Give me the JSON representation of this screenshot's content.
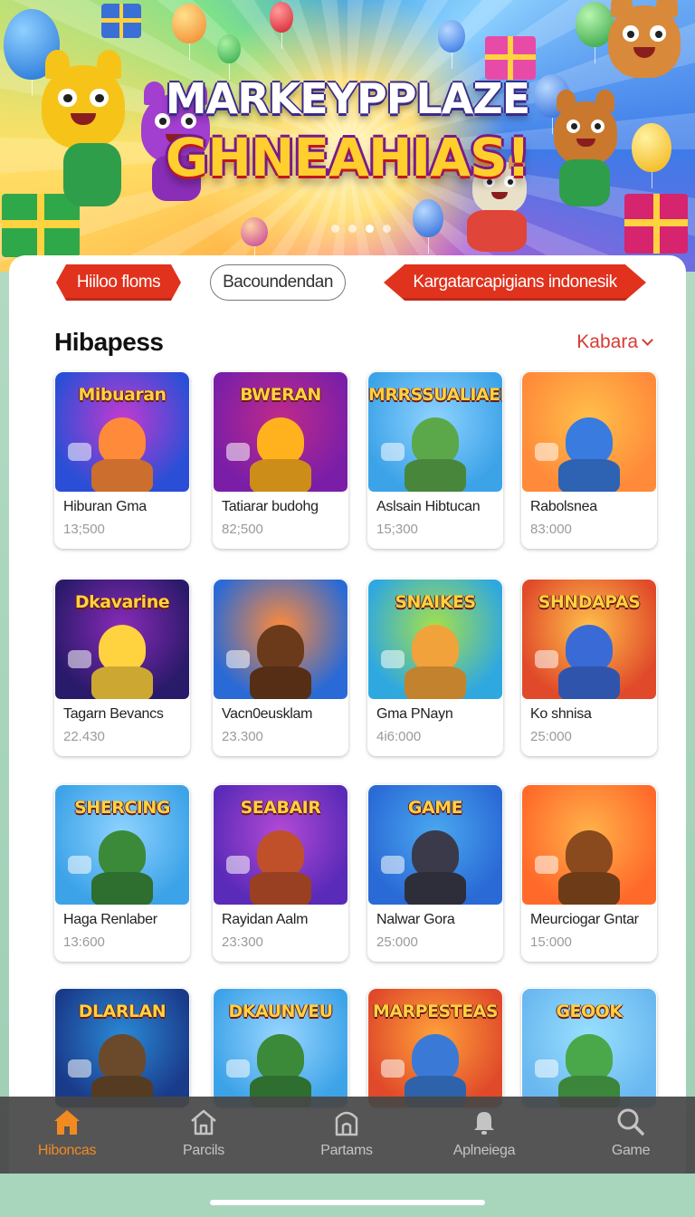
{
  "banner": {
    "title": "MARKEYPPLAZE",
    "subtitle": "GHNEAHIAS!",
    "carousel_dots": 4,
    "active_dot": 3
  },
  "filters": [
    {
      "label": "Hiiloo floms",
      "style": "red"
    },
    {
      "label": "Bacoundendan",
      "style": "outline"
    },
    {
      "label": "Kargatarcapigians indonesik",
      "style": "red"
    }
  ],
  "section": {
    "title": "Hibapess",
    "more_label": "Kabara"
  },
  "items": [
    {
      "name": "Hiburan Gma",
      "price": "13;500",
      "logo": "Mibuaran",
      "theme": "controller"
    },
    {
      "name": "Tatiarar budohg",
      "price": "82;500",
      "logo": "BWERAN",
      "theme": "trophy"
    },
    {
      "name": "Aslsain Hibtucan",
      "price": "15;300",
      "logo": "MRRSSUALIAEI",
      "theme": "kids"
    },
    {
      "name": "Rabolsnea",
      "price": "83:000",
      "logo": "",
      "theme": "family"
    },
    {
      "name": "Tagarn Bevancs",
      "price": "22.430",
      "logo": "Dkavarine",
      "theme": "agent"
    },
    {
      "name": "Vacn0eusklam",
      "price": "23.300",
      "logo": "",
      "theme": "cowboy"
    },
    {
      "name": "Gma PNayn",
      "price": "4i6:000",
      "logo": "SNAIKES",
      "theme": "fox"
    },
    {
      "name": "Ko shnisa",
      "price": "25:000",
      "logo": "SHNDAPAS",
      "theme": "arena"
    },
    {
      "name": "Haga Renlaber",
      "price": "13:600",
      "logo": "SHERCING",
      "theme": "crowd"
    },
    {
      "name": "Rayidan Aalm",
      "price": "23:300",
      "logo": "SEABAIR",
      "theme": "hero"
    },
    {
      "name": "Nalwar Gora",
      "price": "25:000",
      "logo": "GAME",
      "theme": "pad"
    },
    {
      "name": "Meurciogar Gntar",
      "price": "15:000",
      "logo": "",
      "theme": "bear"
    },
    {
      "name": "",
      "price": "",
      "logo": "DLARLAN",
      "theme": "soldier"
    },
    {
      "name": "",
      "price": "",
      "logo": "DKAUNVEU",
      "theme": "parade"
    },
    {
      "name": "",
      "price": "",
      "logo": "MARPESTEAS",
      "theme": "party"
    },
    {
      "name": "",
      "price": "",
      "logo": "GEOOK",
      "theme": "meadow"
    }
  ],
  "nav": [
    {
      "label": "Hiboncas",
      "icon": "home-icon",
      "active": true
    },
    {
      "label": "Parcils",
      "icon": "house-outline-icon",
      "active": false
    },
    {
      "label": "Partams",
      "icon": "door-icon",
      "active": false
    },
    {
      "label": "Aplneiega",
      "icon": "bell-icon",
      "active": false
    },
    {
      "label": "Game",
      "icon": "search-icon",
      "active": false
    }
  ],
  "colors": {
    "accent_red": "#e0321d",
    "link_red": "#d83a34",
    "nav_active": "#f28a22",
    "nav_bg": "#464646",
    "page_bg": "#a8d6bc"
  }
}
